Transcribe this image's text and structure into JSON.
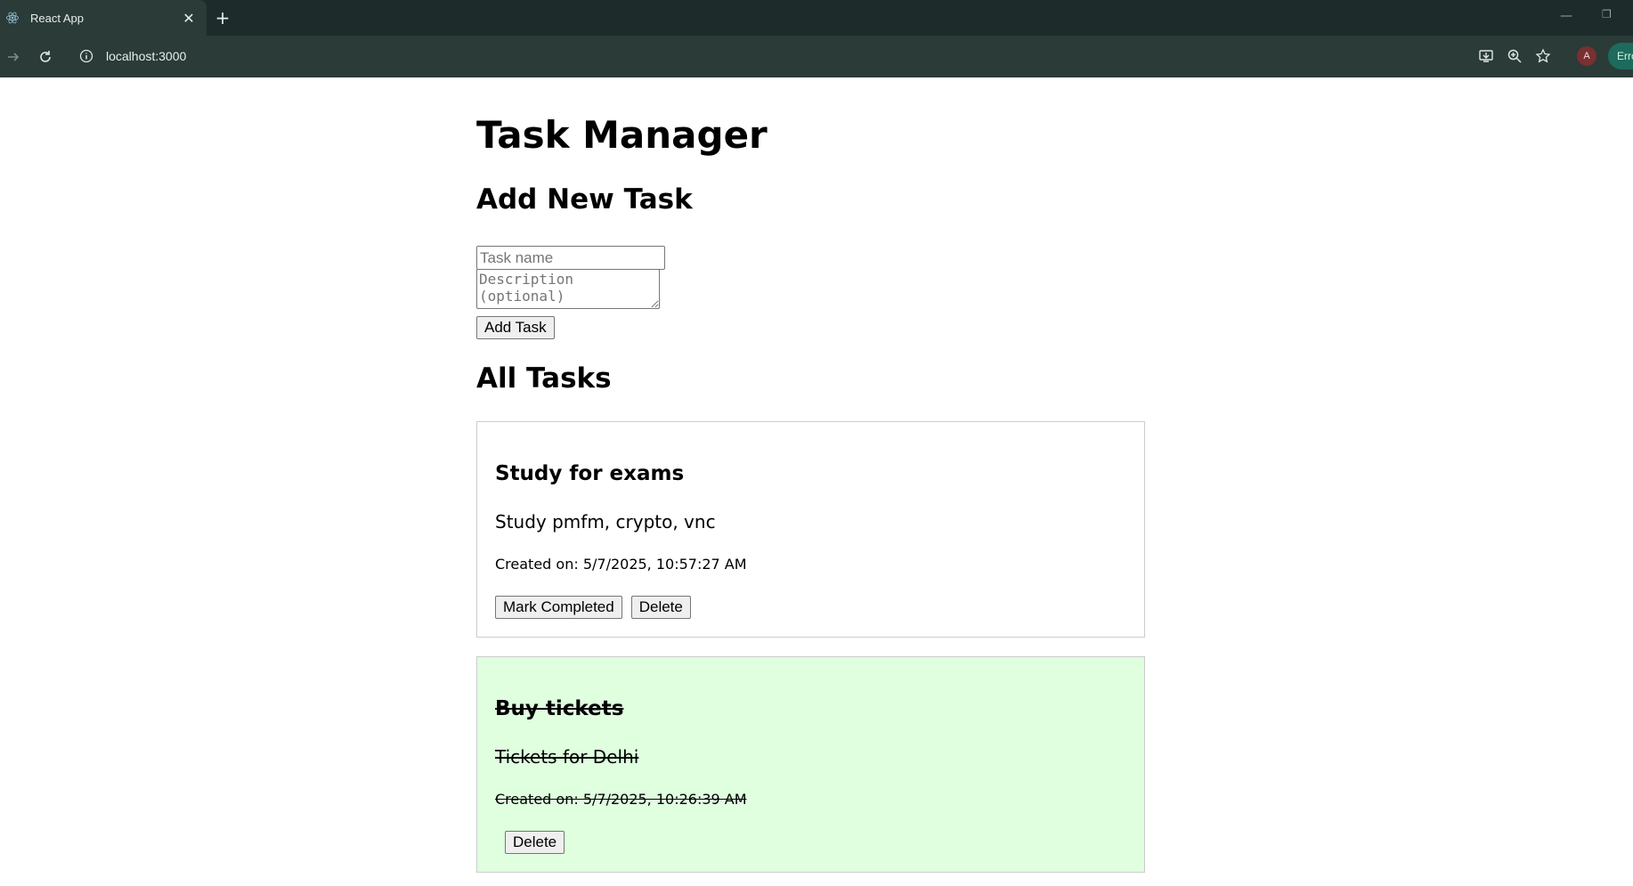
{
  "browser": {
    "tab_title": "React App",
    "url": "localhost:3000",
    "profile_initial": "A",
    "error_label": "Erro"
  },
  "app": {
    "title": "Task Manager",
    "add_section_title": "Add New Task",
    "task_name_placeholder": "Task name",
    "description_placeholder": "Description (optional)",
    "add_button_label": "Add Task",
    "list_section_title": "All Tasks",
    "tasks": [
      {
        "name": "Study for exams",
        "description": "Study pmfm, crypto, vnc",
        "created": "Created on: 5/7/2025, 10:57:27 AM",
        "completed": false,
        "complete_button_label": "Mark Completed",
        "delete_button_label": "Delete"
      },
      {
        "name": "Buy tickets",
        "description": "Tickets for Delhi",
        "created": "Created on: 5/7/2025, 10:26:39 AM",
        "completed": true,
        "delete_button_label": "Delete"
      }
    ]
  },
  "colors": {
    "completed_card_bg": "#dfffdf",
    "chrome_bg": "#1d2b2a",
    "toolbar_bg": "#2a3b38"
  }
}
